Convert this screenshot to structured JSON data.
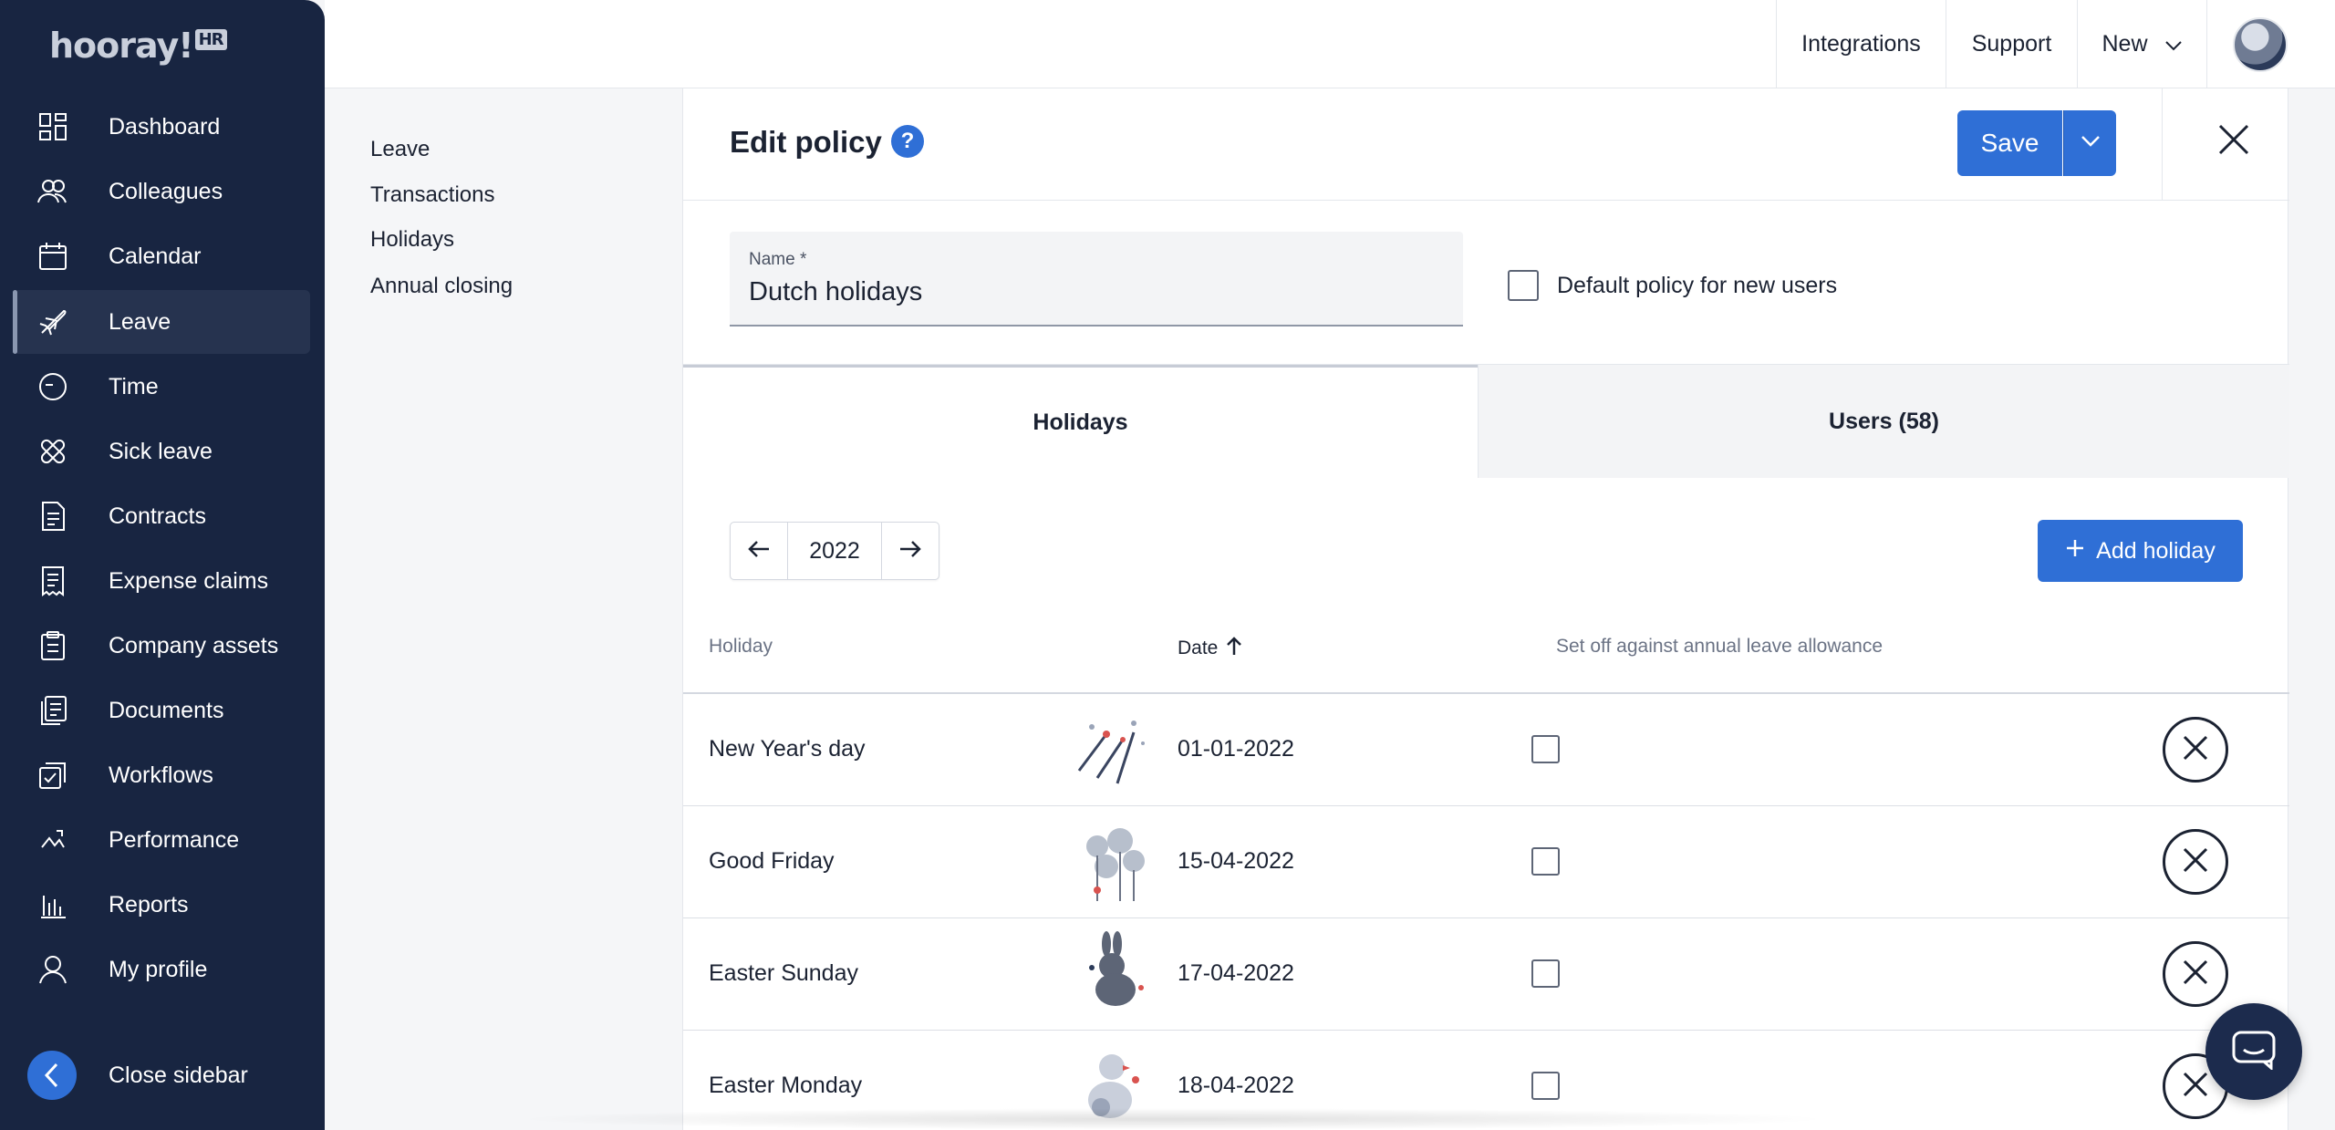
{
  "brand": {
    "logo_text": "hooray!",
    "logo_badge": "HR"
  },
  "sidebar": {
    "items": [
      {
        "label": "Dashboard",
        "icon": "dashboard-icon"
      },
      {
        "label": "Colleagues",
        "icon": "colleagues-icon"
      },
      {
        "label": "Calendar",
        "icon": "calendar-icon"
      },
      {
        "label": "Leave",
        "icon": "airplane-icon",
        "active": true
      },
      {
        "label": "Time",
        "icon": "clock-icon"
      },
      {
        "label": "Sick leave",
        "icon": "bandage-icon"
      },
      {
        "label": "Contracts",
        "icon": "contract-icon"
      },
      {
        "label": "Expense claims",
        "icon": "receipt-icon"
      },
      {
        "label": "Company assets",
        "icon": "clipboard-icon"
      },
      {
        "label": "Documents",
        "icon": "documents-icon"
      },
      {
        "label": "Workflows",
        "icon": "workflow-icon"
      },
      {
        "label": "Performance",
        "icon": "performance-icon"
      },
      {
        "label": "Reports",
        "icon": "reports-icon"
      },
      {
        "label": "My profile",
        "icon": "profile-icon"
      }
    ],
    "close_label": "Close sidebar"
  },
  "topbar": {
    "integrations": "Integrations",
    "support": "Support",
    "new": "New"
  },
  "subnav": {
    "items": [
      "Leave",
      "Transactions",
      "Holidays",
      "Annual closing"
    ]
  },
  "panel": {
    "title": "Edit policy",
    "help": "?",
    "save_label": "Save",
    "name_label": "Name *",
    "name_value": "Dutch holidays",
    "default_label": "Default policy for new users",
    "tabs": [
      {
        "label": "Holidays",
        "active": true
      },
      {
        "label": "Users (58)",
        "active": false
      }
    ],
    "year": "2022",
    "add_holiday": "Add holiday",
    "columns": {
      "holiday": "Holiday",
      "date": "Date",
      "setoff": "Set off against annual leave allowance"
    },
    "rows": [
      {
        "name": "New Year's day",
        "date": "01-01-2022",
        "image": "fireworks-image"
      },
      {
        "name": "Good Friday",
        "date": "15-04-2022",
        "image": "flowers-image"
      },
      {
        "name": "Easter Sunday",
        "date": "17-04-2022",
        "image": "bunny-image"
      },
      {
        "name": "Easter Monday",
        "date": "18-04-2022",
        "image": "chick-image"
      }
    ]
  },
  "colors": {
    "sidebar_bg": "#182541",
    "accent": "#2f6fd6",
    "text": "#1b2232"
  }
}
